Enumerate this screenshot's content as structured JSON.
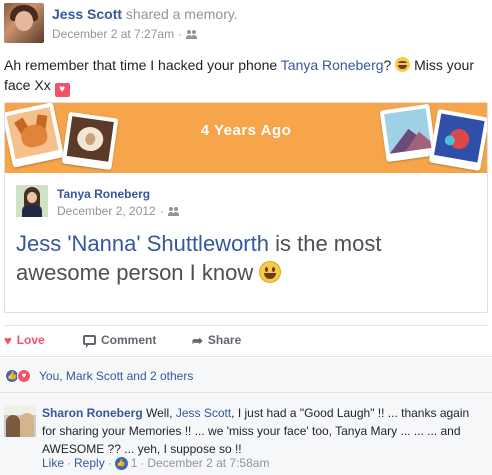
{
  "post": {
    "author": "Jess Scott",
    "action": " shared a memory.",
    "timestamp": "December 2 at 7:27am",
    "separator": "·",
    "audience_icon": "friends-icon",
    "text_before": "Ah remember that time I hacked your phone ",
    "mention": "Tanya Roneberg",
    "text_middle": "? ",
    "text_after": " Miss your face Xx ",
    "emoji_1": "laughing-emoji",
    "emoji_2": "heart-emoji"
  },
  "memory": {
    "banner_title": "4 Years Ago",
    "banner_color": "#f7a54a",
    "shared_author": "Tanya Roneberg",
    "shared_timestamp": "December 2, 2012",
    "shared_separator": "·",
    "shared_mention": "Jess 'Nanna' Shuttleworth",
    "shared_text": " is the most awesome person I know ",
    "shared_emoji": "smiling-emoji"
  },
  "actions": {
    "love": "Love",
    "comment": "Comment",
    "share": "Share"
  },
  "reactions": {
    "summary": "You, Mark Scott and 2 others",
    "icons": [
      "like-icon",
      "love-icon"
    ]
  },
  "comment": {
    "author": "Sharon Roneberg",
    "text_before": " Well, ",
    "mention": "Jess Scott",
    "text_after": ", I just had a \"Good Laugh\" !! ... thanks again for sharing your Memories !! ... we 'miss your face' too, Tanya Mary ... ... ... and AWESOME ?? ... yeh, I suppose so !!",
    "like": "Like",
    "dot1": " · ",
    "reply": "Reply",
    "dot2": " · ",
    "like_count": "1",
    "dot3": " · ",
    "timestamp": "December 2 at 7:58am"
  },
  "colors": {
    "link": "#365899",
    "love": "#f25268",
    "muted": "#90949c"
  }
}
